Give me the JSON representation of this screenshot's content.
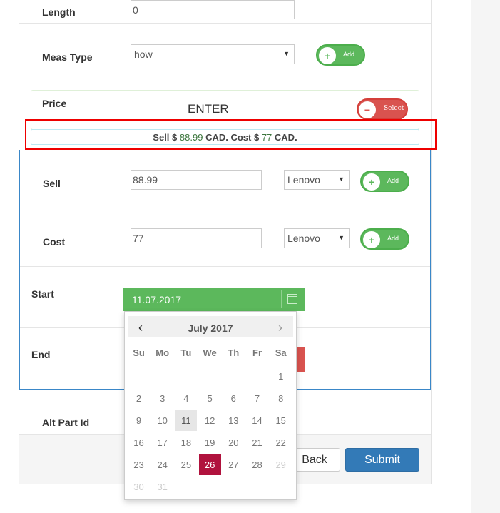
{
  "form": {
    "length": {
      "label": "Length",
      "value": "0"
    },
    "meas_type": {
      "label": "Meas Type",
      "selected": "how",
      "add_label": "Add"
    },
    "price": {
      "label": "Price",
      "enter_text": "ENTER",
      "select_label": "Select"
    },
    "summary": {
      "sell_prefix": "Sell $",
      "sell_value": "88.99",
      "sell_mid": "CAD. Cost $",
      "cost_value": "77",
      "cost_suffix": "CAD."
    },
    "sell": {
      "label": "Sell",
      "value": "88.99",
      "vendor": "Lenovo",
      "add_label": "Add"
    },
    "cost": {
      "label": "Cost",
      "value": "77",
      "vendor": "Lenovo",
      "add_label": "Add"
    },
    "start": {
      "label": "Start",
      "value": "11.07.2017"
    },
    "end": {
      "label": "End"
    },
    "alt_part": {
      "label": "Alt Part Id"
    },
    "buttons": {
      "back": "Back",
      "submit": "Submit"
    }
  },
  "datepicker": {
    "month_label": "July 2017",
    "prev_icon": "chevron-left-icon",
    "next_icon": "chevron-right-icon",
    "weekdays": [
      "Su",
      "Mo",
      "Tu",
      "We",
      "Th",
      "Fr",
      "Sa"
    ],
    "weeks": [
      [
        "",
        "",
        "",
        "",
        "",
        "",
        "1"
      ],
      [
        "2",
        "3",
        "4",
        "5",
        "6",
        "7",
        "8"
      ],
      [
        "9",
        "10",
        "11",
        "12",
        "13",
        "14",
        "15"
      ],
      [
        "16",
        "17",
        "18",
        "19",
        "20",
        "21",
        "22"
      ],
      [
        "23",
        "24",
        "25",
        "26",
        "27",
        "28",
        "29"
      ],
      [
        "30",
        "31",
        "",
        "",
        "",
        "",
        ""
      ]
    ],
    "today": "11",
    "selected": "26",
    "disabled": [
      "29",
      "30",
      "31"
    ]
  },
  "colors": {
    "success": "#5cb85c",
    "danger": "#d9534f",
    "primary": "#337ab7",
    "selected_day": "#b0123d",
    "highlight_outline": "#e00000",
    "panel_border": "#3a87c8"
  }
}
